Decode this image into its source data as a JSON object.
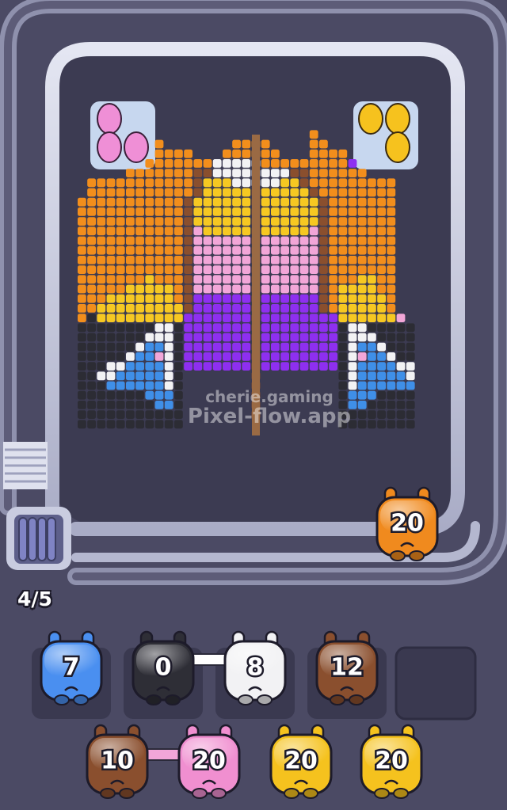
{
  "queue": {
    "counter": "4/5"
  },
  "watermark": {
    "line1": "cherie.gaming",
    "line2": "Pixel-flow.app"
  },
  "conveyor_shooter": {
    "count": "20",
    "color": "#f08a1e"
  },
  "slots": [
    {
      "count": "7",
      "color": "#4a8ff0",
      "empty": false
    },
    {
      "count": "0",
      "color": "#2e2e36",
      "empty": false,
      "linked_with": 2
    },
    {
      "count": "8",
      "color": "#f2f2f4",
      "empty": false,
      "linked_with": 1
    },
    {
      "count": "12",
      "color": "#8a4f2e",
      "empty": false
    },
    {
      "count": "",
      "color": "#3a3950",
      "empty": true
    }
  ],
  "bottom_row": [
    {
      "count": "10",
      "color": "#8a4f2e",
      "linked_with": 1
    },
    {
      "count": "20",
      "color": "#f08fd0",
      "linked_with": 0
    },
    {
      "count": "20",
      "color": "#f5c21e"
    },
    {
      "count": "20",
      "color": "#f5c21e"
    }
  ],
  "corner_eggs": {
    "left_color": "#ef8fd6",
    "right_color": "#f6c21e"
  },
  "colors": {
    "background": "#4b4a64",
    "track": "#c9cce0",
    "board": "#3c3b52"
  },
  "pixel_art": {
    "palette": {
      "O": "#f28e1c",
      "Y": "#f6c822",
      "W": "#f2f2f4",
      "P": "#f2a6d8",
      "V": "#8e2ff0",
      "B": "#8a4f2e",
      "K": "#2c2c34",
      "L": "#3f8fe8",
      "N": "#4a4b5e"
    },
    "rows": [
      "....................................",
      "....................................",
      "........................O...........",
      "........O.......OOOO....OO..........",
      "........OOOO...OOOOOO...OOOO........",
      ".......OOOOOOOWWWWWOOOOOOOOOV.......",
      ".....OOOOOOOBBWWWWWWWWBBOOOOOO......",
      ".OOOOOOOOOOOBYYYWWWWWYYBOOOOOOOOO...",
      ".OOOOOOOOOOOBYYYYYBYYYYYBOOOOOOOO...",
      "OOOOOOOOOOOBYYYYYYBYYYYYYBOOOOOOO...",
      "OOOOOOOOOOOBYYYYYYBYYYYYYBOOOOOOO...",
      "OOOOOOOOOOOBYYYYYYBYYYYYYBOOOOOOO...",
      "OOOOOOOOOOOBPYYYYYBYYYYYPBOOOOOOO...",
      "OOOOOOOOOOOBPPPPPPBPPPPPPBOOOOOOO...",
      "OOOOOOOOOOOBPPPPPPBPPPPPPBOOOOOOO...",
      "OOOOOOOOOOOBPPPPPPBPPPPPPBOOOOOOO...",
      "OOOOOOOOOOOBPPPPPPBPPPPPPBOOOOOOO...",
      "OOOOOOOYOOOBPPPPPPBPPPPPPBOOOYYOO...",
      "OOOOOYYYYYOBPPPPPPBPPPPPPBOYYYYOO...",
      "OOOYYYYYYYOBVVVVVVBVVVVVVBOYYYYYO...",
      "OOYYYYYYYYYBVVVVVVBVVVVVVBOYYYYYO...",
      "OKYYYYYYYYYVVVVVVVBVVVVVVVVYYYYYYP..",
      "KKKKKKKKWWKVVVVVVVBVVVVVVVVKWWKKKKK.",
      "KKKKKKKWWWKVVVVVVVBVVVVVVVVKWWWKKKK.",
      "KKKKKKWLLWKVVVVVVVBVVVVVVVVKWLLWKKK.",
      "KKKKKWLLPWKVVVVVVVBVVVVVVVVKWPLLWKK.",
      "KKKWWLLLLWKVVVVVVVBVVVVVVVVKWLLLLWW.",
      "KKWWLLLLLWK.......B........KWLLLLLW.",
      "KKKLLLLLLWK.......B........KWLLLLLL.",
      "KKKKKKKLLLK.......B........KLLLKKKK.",
      "KKKKKKKKLLK.......B........KLLKKKKK.",
      "KKKKKKKKKKK.......B........KKKKKKKK.",
      "KKKKKKKKKKK................KKKKKKKK."
    ]
  }
}
